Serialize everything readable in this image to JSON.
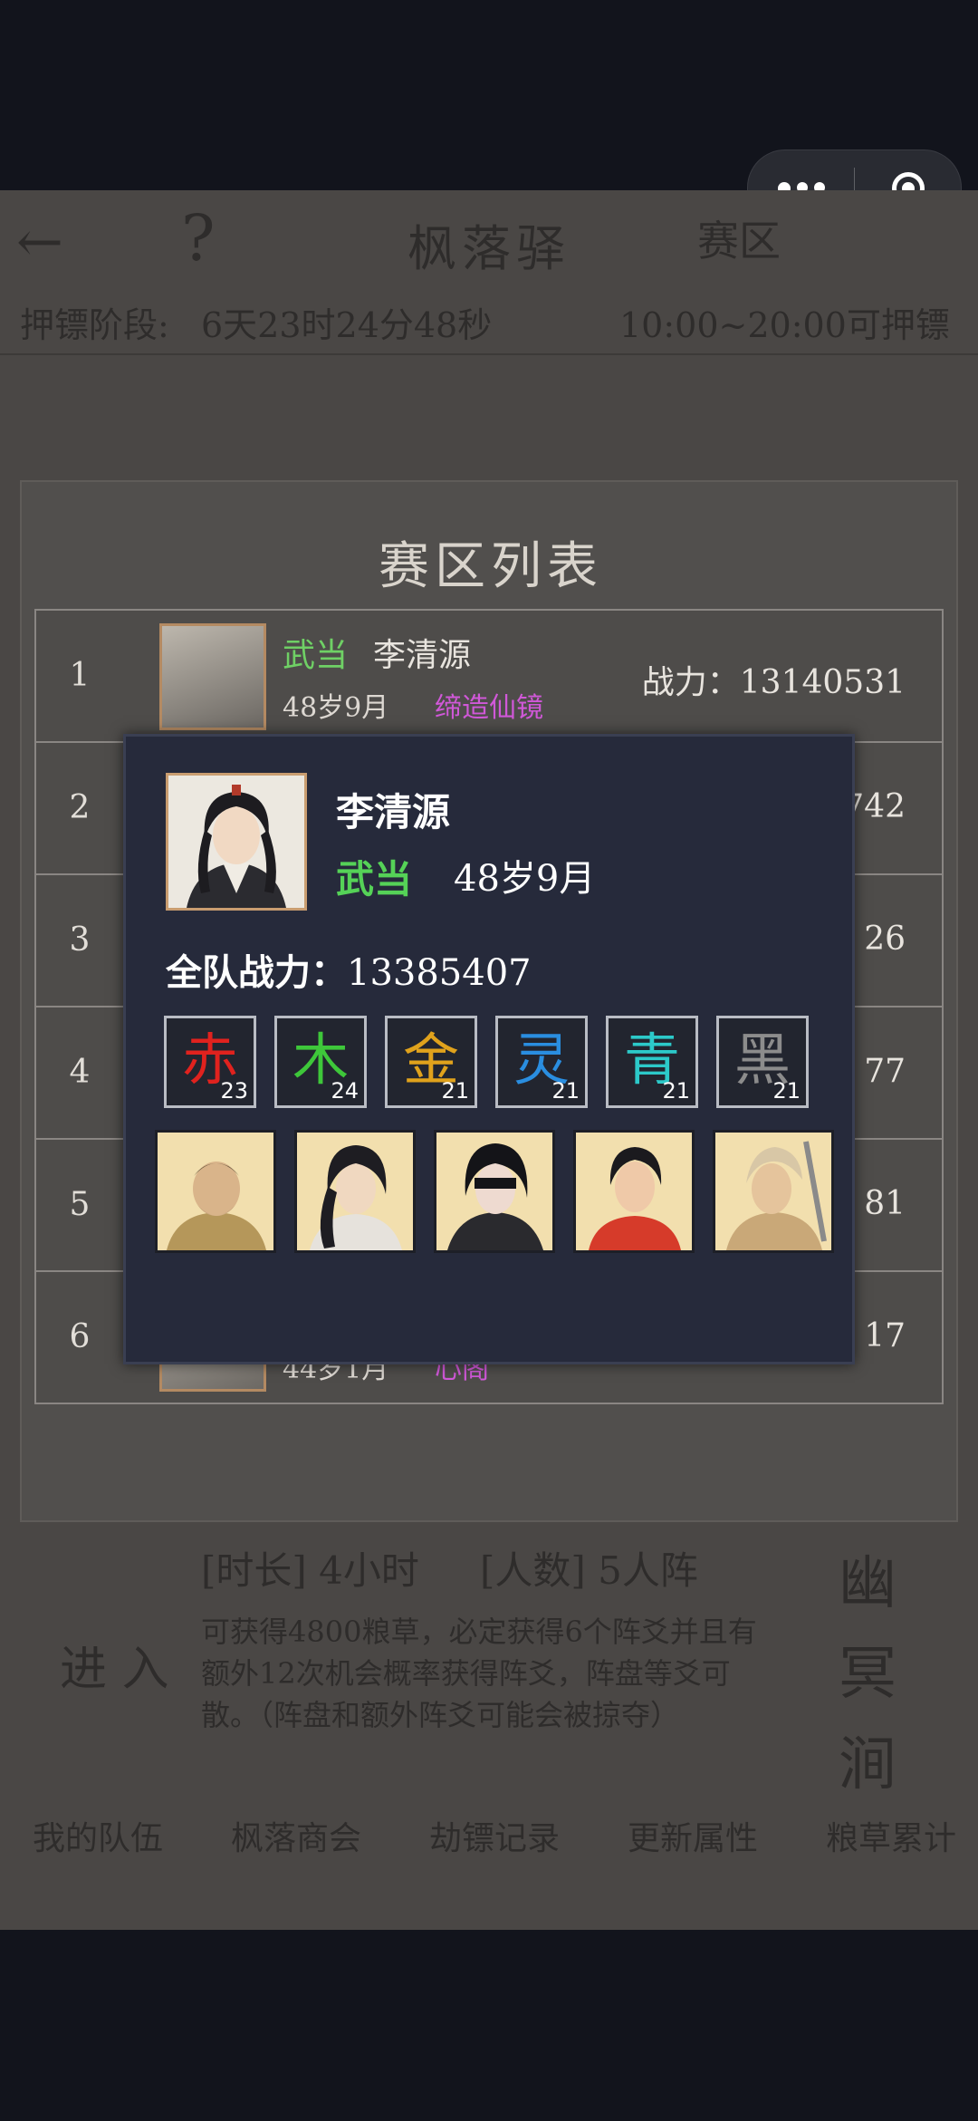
{
  "header": {
    "back_icon": "back-arrow-icon",
    "help_icon": "question-mark-icon",
    "title": "枫落驿",
    "right_tab": "赛区"
  },
  "escort_bar": {
    "phase_label": "押镖阶段:",
    "countdown": "6天23时24分48秒",
    "hours": "10:00~20:00可押镖"
  },
  "zone_list": {
    "title": "赛区列表",
    "rows": [
      {
        "rank": "1",
        "sect": "武当",
        "name": "李清源",
        "age": "48岁9月",
        "title": "缔造仙镜",
        "power_label": "战力：",
        "power": "13140531"
      },
      {
        "rank": "2",
        "power_tail": "742"
      },
      {
        "rank": "3",
        "power_tail": "26"
      },
      {
        "rank": "4",
        "power_tail": "77"
      },
      {
        "rank": "5",
        "power_tail": "81"
      },
      {
        "rank": "6",
        "age": "44岁1月",
        "title": "心阁",
        "power_tail": "17"
      }
    ]
  },
  "popup": {
    "name": "李清源",
    "sect": "武当",
    "age": "48岁9月",
    "team_power_label": "全队战力：",
    "team_power": "13385407",
    "elements": [
      {
        "char": "赤",
        "level": "23",
        "color": "#e0221e"
      },
      {
        "char": "木",
        "level": "24",
        "color": "#3ec73a"
      },
      {
        "char": "金",
        "level": "21",
        "color": "#e0a21c"
      },
      {
        "char": "灵",
        "level": "21",
        "color": "#2a8ee0"
      },
      {
        "char": "青",
        "level": "21",
        "color": "#2cc9c9"
      },
      {
        "char": "黑",
        "level": "21",
        "color": "#8c8c8c"
      }
    ],
    "heroes": [
      "hero-1",
      "hero-2",
      "hero-3",
      "hero-4",
      "hero-5"
    ]
  },
  "bottom_section": {
    "duration": "[时长] 4小时",
    "people": "[人数] 5人阵",
    "enter": "进 入",
    "description": "可获得4800粮草，必定获得6个阵爻并且有额外12次机会概率获得阵爻，阵盘等爻可散。（阵盘和额外阵爻可能会被掠夺）",
    "side_title": "幽冥涧",
    "tabs": [
      "我的队伍",
      "枫落商会",
      "劫镖记录",
      "更新属性",
      "粮草累计"
    ]
  },
  "colors": {
    "sect_green": "#55d257",
    "title_purple": "#d058d8",
    "popup_bg": "#262a3b"
  }
}
